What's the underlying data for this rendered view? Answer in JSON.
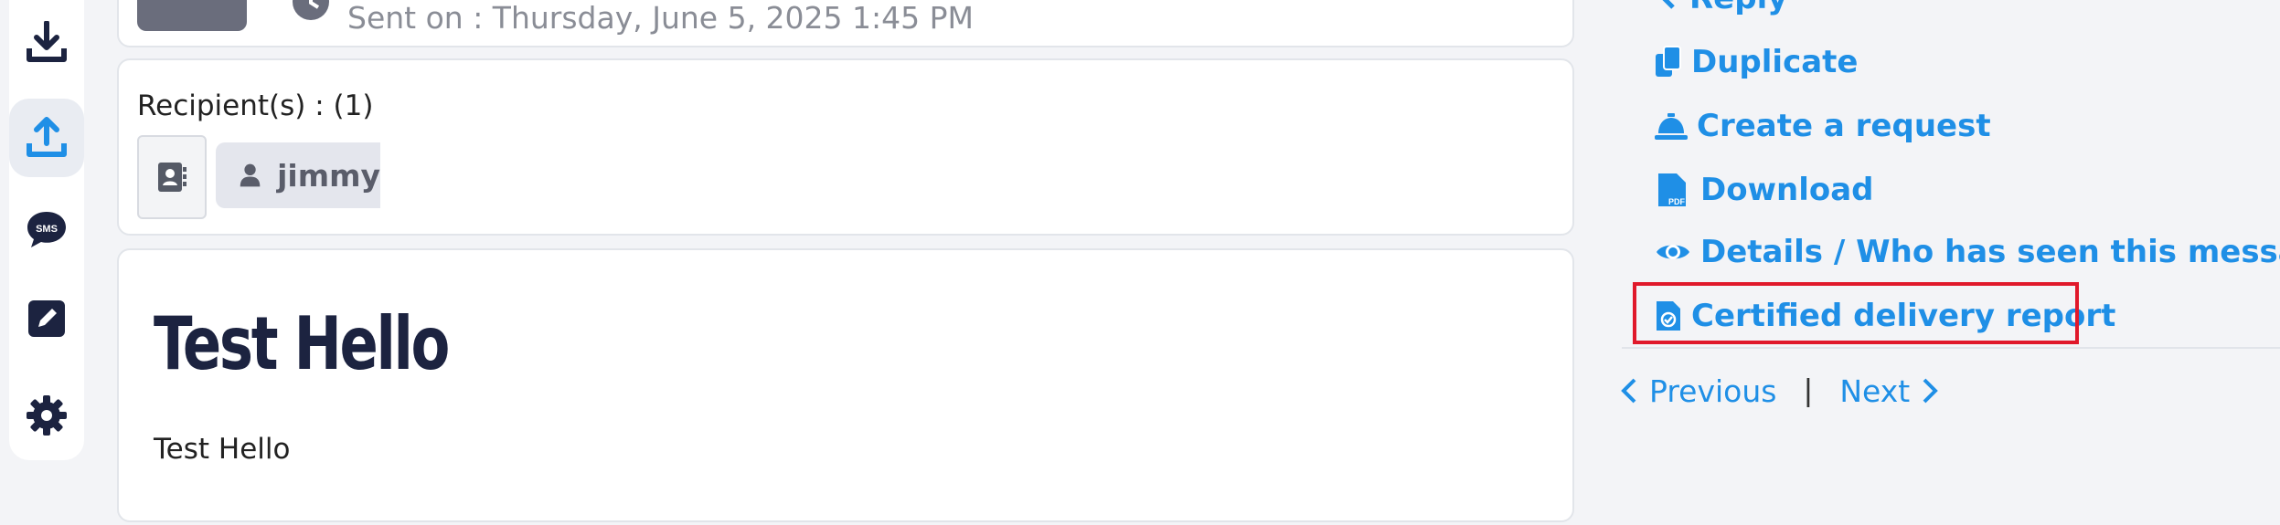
{
  "sidebar": {
    "items": [
      {
        "name": "download",
        "icon": "download-icon",
        "active": false
      },
      {
        "name": "upload",
        "icon": "upload-icon",
        "active": true
      },
      {
        "name": "sms",
        "icon": "sms-icon",
        "label": "SMS",
        "active": false
      },
      {
        "name": "edit",
        "icon": "pencil-square-icon",
        "active": false
      },
      {
        "name": "settings",
        "icon": "gear-icon",
        "active": false
      }
    ]
  },
  "header": {
    "sent_on_text": "Sent on :  Thursday, June 5, 2025 1:45 PM"
  },
  "recipients": {
    "label": "Recipient(s) : (1)",
    "list": [
      {
        "name": "jimmy"
      }
    ]
  },
  "message": {
    "title": "Test Hello",
    "body": "Test Hello"
  },
  "actions": {
    "reply": "Reply",
    "duplicate": "Duplicate",
    "create_request": "Create a request",
    "download": "Download",
    "details": "Details / Who has seen this message?",
    "certified_report": "Certified delivery report"
  },
  "navigation": {
    "previous": "Previous",
    "separator": "|",
    "next": "Next"
  },
  "colors": {
    "accent": "#1f8fe6",
    "highlight_border": "#e0192b",
    "sidebar_icon": "#1c2340"
  }
}
